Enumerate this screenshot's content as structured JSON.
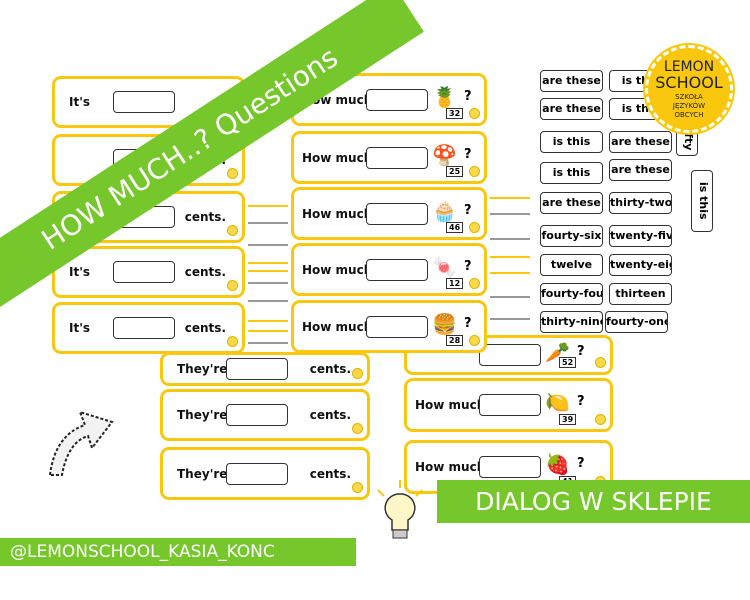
{
  "banner": {
    "title": "HOW MUCH..? Questions",
    "color": "#76c72b"
  },
  "logo": {
    "line1": "LEMON",
    "line2": "SCHOOL",
    "line3": "SZKOŁA JĘZYKÓW OBCYCH",
    "color": "#f9c80e"
  },
  "left_cards": [
    {
      "a": "It's",
      "b": ""
    },
    {
      "a": "",
      "b": "cents."
    },
    {
      "a": "",
      "b": "cents."
    },
    {
      "a": "It's",
      "b": "cents."
    },
    {
      "a": "It's",
      "b": "cents."
    }
  ],
  "lower_cards": [
    {
      "a": "They're",
      "b": "cents."
    },
    {
      "a": "They're",
      "b": "cents."
    },
    {
      "a": "They're",
      "b": "cents."
    }
  ],
  "question_cards": [
    {
      "label": "How much",
      "q": "?",
      "num": "32",
      "icon": "pineapple-icon",
      "glyph": "🍍"
    },
    {
      "label": "How much",
      "q": "?",
      "num": "25",
      "icon": "mushroom-icon",
      "glyph": "🍄"
    },
    {
      "label": "How much",
      "q": "?",
      "num": "46",
      "icon": "muffin-icon",
      "glyph": "🧁"
    },
    {
      "label": "How much",
      "q": "?",
      "num": "12",
      "icon": "candy-icon",
      "glyph": "🍬"
    },
    {
      "label": "How much",
      "q": "?",
      "num": "28",
      "icon": "burger-icon",
      "glyph": "🍔"
    }
  ],
  "right_cards": [
    {
      "label": "",
      "q": "?",
      "num": "52",
      "icon": "carrot-icon",
      "glyph": "🥕"
    },
    {
      "label": "How much",
      "q": "?",
      "num": "39",
      "icon": "lemon-icon",
      "glyph": "🍋"
    },
    {
      "label": "How much",
      "q": "?",
      "num": "41",
      "icon": "strawberry-icon",
      "glyph": "🍓"
    }
  ],
  "chips": [
    "are these",
    "is this",
    "are these",
    "is this",
    "is this",
    "are these",
    "is this",
    "are these",
    "are these",
    "thirty-two",
    "fourty-six",
    "twenty-five",
    "twelve",
    "twenty-eight",
    "fourty-four",
    "thirteen",
    "thirty-nine",
    "fourty-one"
  ],
  "vertical_chips": [
    "fifty",
    "is this"
  ],
  "subtitle": "DIALOG W SKLEPIE",
  "handle": "@LEMONSCHOOL_KASIA_KONC",
  "accent": "#76c72b"
}
